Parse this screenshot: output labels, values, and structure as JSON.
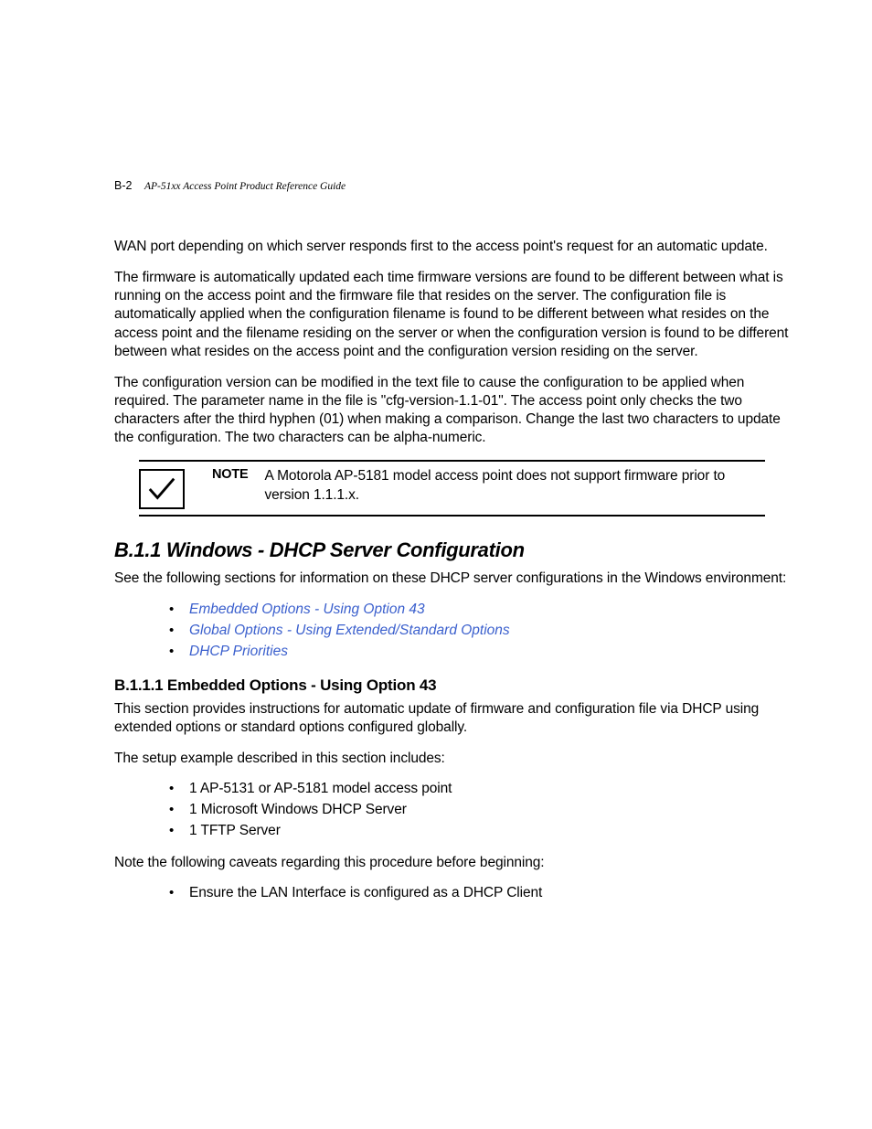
{
  "header": {
    "page_num": "B-2",
    "title": "AP-51xx Access Point Product Reference Guide"
  },
  "paragraphs": {
    "p1": "WAN port depending on which server responds first to the access point's request for an automatic update.",
    "p2": "The firmware is automatically updated each time firmware versions are found to be different between what is running on the access point and the firmware file that resides on the server. The configuration file is automatically applied when the configuration filename is found to be different between what resides on the access point and the filename residing on the server or when the configuration version is found to be different between what resides on the access point and the configuration version residing on the server.",
    "p3": "The configuration version can be modified in the text file to cause the configuration to be applied when required. The parameter name in the file is \"cfg-version-1.1-01\". The access point only checks the two characters after the third hyphen (01) when making a comparison. Change the last two characters to update the configuration. The two characters can be alpha-numeric."
  },
  "note": {
    "label": "NOTE",
    "text": "A Motorola AP-5181 model access point does not support firmware prior to version 1.1.1.x."
  },
  "section_b11": {
    "heading": "B.1.1  Windows - DHCP Server Configuration",
    "intro": "See the following sections for information on these DHCP server configurations in the Windows environment:",
    "links": [
      "Embedded Options - Using Option 43",
      "Global Options - Using Extended/Standard Options",
      "DHCP Priorities"
    ]
  },
  "section_b111": {
    "heading": "B.1.1.1  Embedded Options - Using Option 43",
    "p1": "This section provides instructions for automatic update of firmware and configuration file via DHCP using extended options or standard options configured globally.",
    "p2": "The setup example described in this section includes:",
    "items": [
      "1 AP-5131 or AP-5181 model access point",
      "1 Microsoft Windows DHCP Server",
      "1 TFTP Server"
    ],
    "p3": "Note the following caveats regarding this procedure before beginning:",
    "caveats": [
      "Ensure the LAN Interface is configured as a DHCP Client"
    ]
  }
}
